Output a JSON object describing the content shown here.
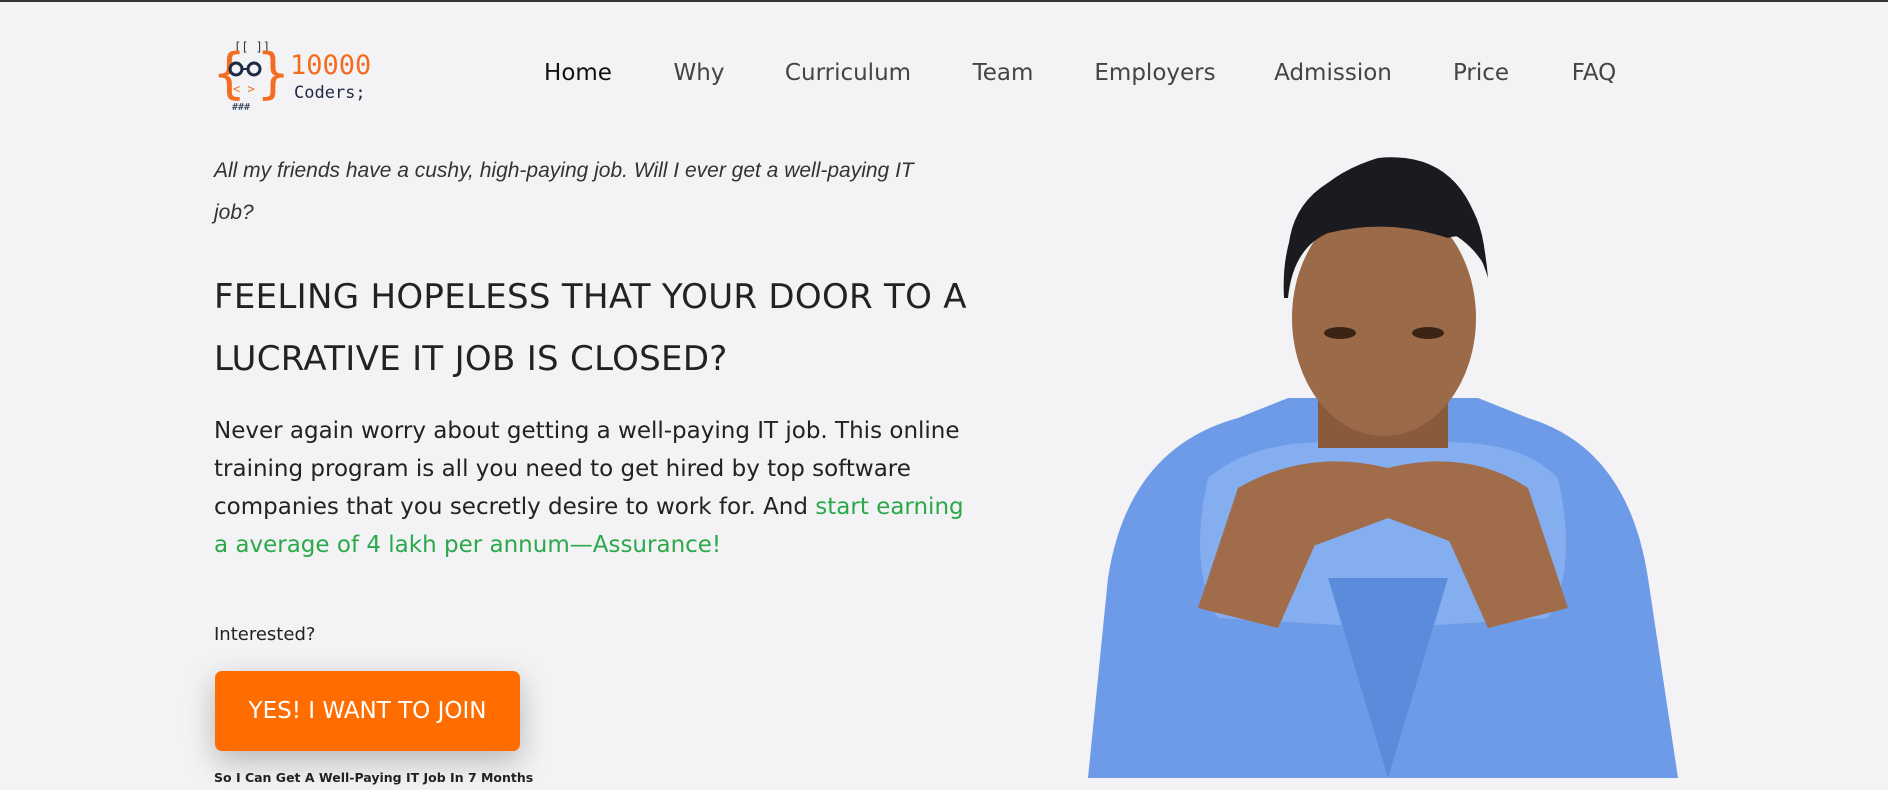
{
  "logo": {
    "line1": "10000",
    "line2": "Coders;"
  },
  "nav": {
    "items": [
      {
        "label": "Home"
      },
      {
        "label": "Why"
      },
      {
        "label": "Curriculum"
      },
      {
        "label": "Team"
      },
      {
        "label": "Employers"
      },
      {
        "label": "Admission"
      },
      {
        "label": "Price"
      },
      {
        "label": "FAQ"
      }
    ]
  },
  "hero": {
    "quote": "All my friends have a cushy, high-paying job. Will I ever get a well-paying IT job?",
    "heading": "FEELING HOPELESS THAT YOUR DOOR TO A LUCRATIVE IT JOB IS CLOSED?",
    "paragraph": "Never again worry about getting a well-paying IT job. This online training program is all you need to get hired by top software companies that you secretly desire to work for. And ",
    "paragraph_highlight": "start earning a average of 4 lakh per annum—Assurance!",
    "interested": "Interested?",
    "cta_label": "YES! I WANT TO JOIN",
    "cta_subtext": "So I Can Get A Well-Paying IT Job In 7 Months"
  },
  "colors": {
    "accent": "#ff6d00",
    "highlight": "#2aa84a",
    "background": "#f3f3f5"
  }
}
